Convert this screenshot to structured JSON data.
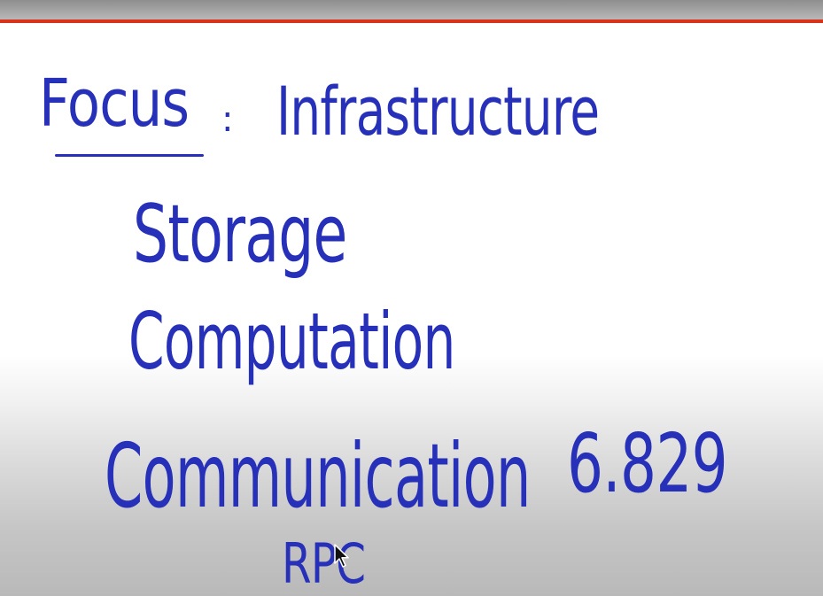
{
  "whiteboard": {
    "focus_label": "Focus",
    "colon": ":",
    "topic": "Infrastructure",
    "items": [
      "Storage",
      "Computation",
      "Communication"
    ],
    "course_number": "6.829",
    "rpc": "RPC"
  },
  "colors": {
    "ink": "#2730b8",
    "accent_rule": "#d9331c"
  },
  "icons": {
    "cursor": "mouse-pointer-icon"
  }
}
